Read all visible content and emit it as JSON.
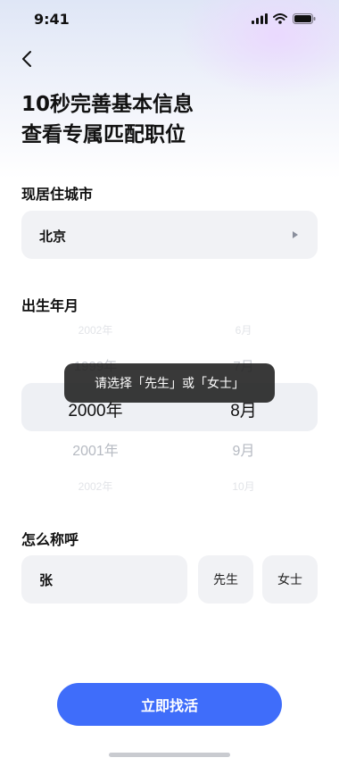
{
  "status_bar": {
    "time": "9:41"
  },
  "title": {
    "line1": "10秒完善基本信息",
    "line2": "查看专属匹配职位"
  },
  "city": {
    "label": "现居住城市",
    "value": "北京"
  },
  "birth": {
    "label": "出生年月",
    "years": [
      "2002年",
      "1999年",
      "2000年",
      "2001年",
      "2002年"
    ],
    "months": [
      "6月",
      "7月",
      "8月",
      "9月",
      "10月"
    ],
    "selected_year": "2000年",
    "selected_month": "8月"
  },
  "toast": {
    "text": "请选择「先生」或「女士」"
  },
  "name": {
    "label": "怎么称呼",
    "value": "张",
    "options": [
      "先生",
      "女士"
    ]
  },
  "submit": {
    "label": "立即找活"
  },
  "colors": {
    "accent": "#3f6dfa",
    "field_bg": "#f1f2f5"
  }
}
